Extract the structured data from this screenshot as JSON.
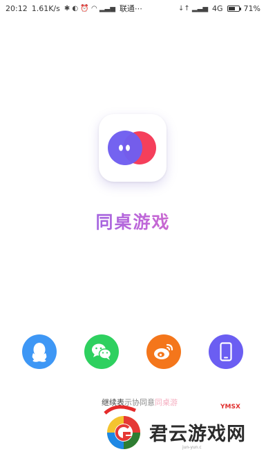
{
  "status_bar": {
    "time": "20:12",
    "net_speed": "1.61K/s",
    "left_icons": "✱ ◐ ⏰ ◠ ▂▃▅",
    "carrier": "联通⋯",
    "data_icon": "↓↑ ▂▃▅",
    "network": "4G",
    "battery_level": 0.71,
    "battery_pct": "71%"
  },
  "app": {
    "title": "同桌游戏",
    "logo_colors": {
      "left_circle": "#6f5ef0",
      "right_circle": "#f53f5b"
    }
  },
  "login_options": [
    {
      "name": "qq",
      "icon": "qq-penguin-icon",
      "color": "#3e97f5"
    },
    {
      "name": "wechat",
      "icon": "wechat-icon",
      "color": "#2ed05f"
    },
    {
      "name": "weibo",
      "icon": "weibo-icon",
      "color": "#f4761b"
    },
    {
      "name": "phone",
      "icon": "phone-icon",
      "color": "#6b5ef2"
    }
  ],
  "footer": {
    "prefix": "继续表",
    "dim": "示协同意",
    "brand": "同桌游"
  },
  "watermark": {
    "text": "君云游戏网",
    "sub": "jun-yun.c",
    "red": "YMSX"
  }
}
